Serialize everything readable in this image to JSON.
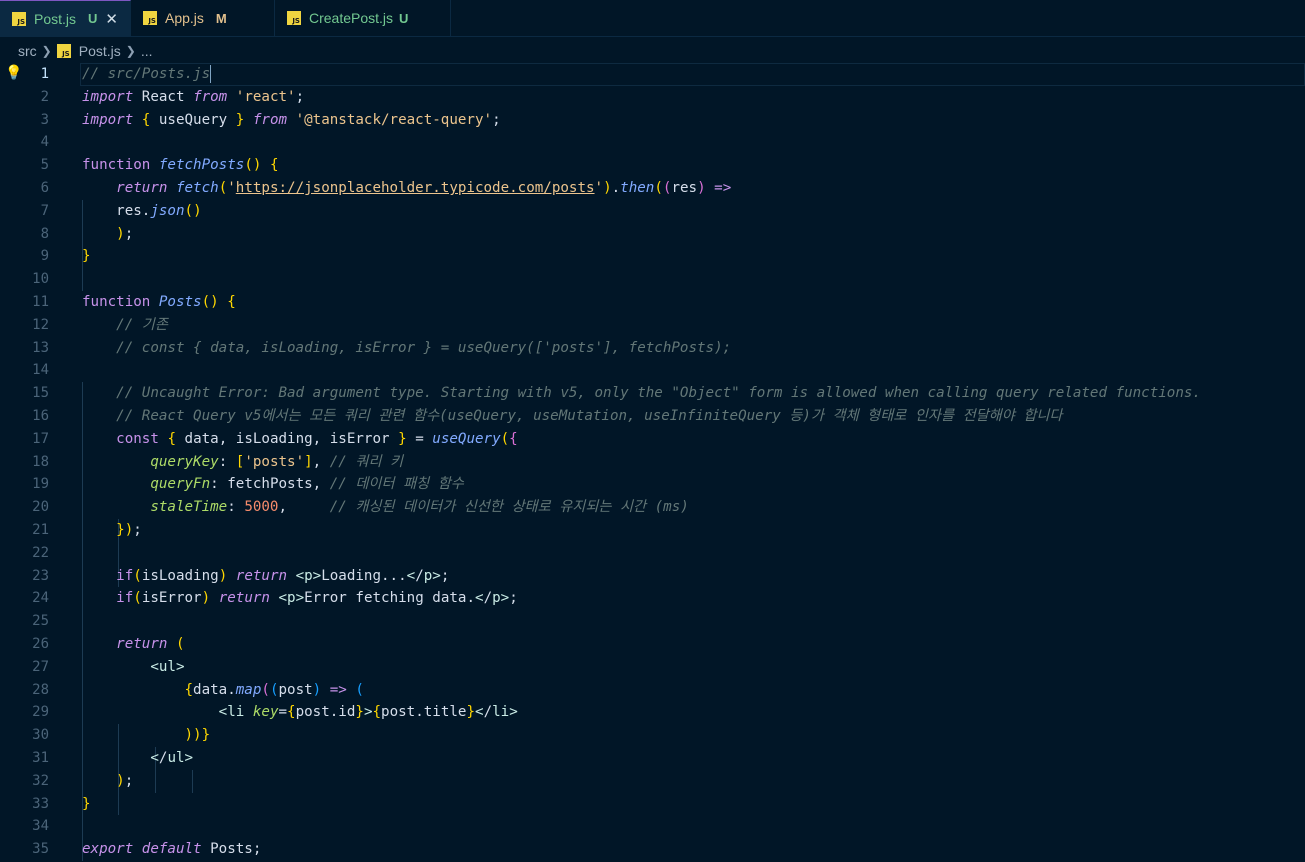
{
  "tabs": [
    {
      "label": "Post.js",
      "status": "U",
      "active": true
    },
    {
      "label": "App.js",
      "status": "M",
      "active": false
    },
    {
      "label": "CreatePost.js",
      "status": "U",
      "active": false
    }
  ],
  "breadcrumb": {
    "folder": "src",
    "file": "Post.js",
    "tail": "..."
  },
  "theme": {
    "background": "#011627",
    "keyword": "#c792ea",
    "string": "#ecc48d",
    "function": "#82aaff",
    "comment": "#637777",
    "status_modified": "#e2c08d",
    "status_untracked": "#73c991"
  },
  "current_line": 1,
  "line_numbers": [
    "1",
    "2",
    "3",
    "4",
    "5",
    "6",
    "7",
    "8",
    "9",
    "10",
    "11",
    "12",
    "13",
    "14",
    "15",
    "16",
    "17",
    "18",
    "19",
    "20",
    "21",
    "22",
    "23",
    "24",
    "25",
    "26",
    "27",
    "28",
    "29",
    "30",
    "31",
    "32",
    "33",
    "34",
    "35"
  ],
  "code": [
    "// src/Posts.js",
    "import React from 'react';",
    "import { useQuery } from '@tanstack/react-query';",
    "",
    "function fetchPosts() {",
    "    return fetch('https://jsonplaceholder.typicode.com/posts').then((res) =>",
    "    res.json()",
    "    );",
    "}",
    "",
    "function Posts() {",
    "    // 기존",
    "    // const { data, isLoading, isError } = useQuery(['posts'], fetchPosts);",
    "",
    "    // Uncaught Error: Bad argument type. Starting with v5, only the \"Object\" form is allowed when calling query related functions.",
    "    // React Query v5에서는 모든 쿼리 관련 함수(useQuery, useMutation, useInfiniteQuery 등)가 객체 형태로 인자를 전달해야 합니다",
    "    const { data, isLoading, isError } = useQuery({",
    "        queryKey: ['posts'], // 쿼리 키",
    "        queryFn: fetchPosts, // 데이터 패칭 함수",
    "        staleTime: 5000,     // 캐싱된 데이터가 신선한 상태로 유지되는 시간 (ms)",
    "    });",
    "",
    "    if(isLoading) return <p>Loading...</p>;",
    "    if(isError) return <p>Error fetching data.</p>;",
    "",
    "    return (",
    "        <ul>",
    "            {data.map((post) => (",
    "                <li key={post.id}>{post.title}</li>",
    "            ))}",
    "        </ul>",
    "    );",
    "}",
    "",
    "export default Posts;"
  ]
}
